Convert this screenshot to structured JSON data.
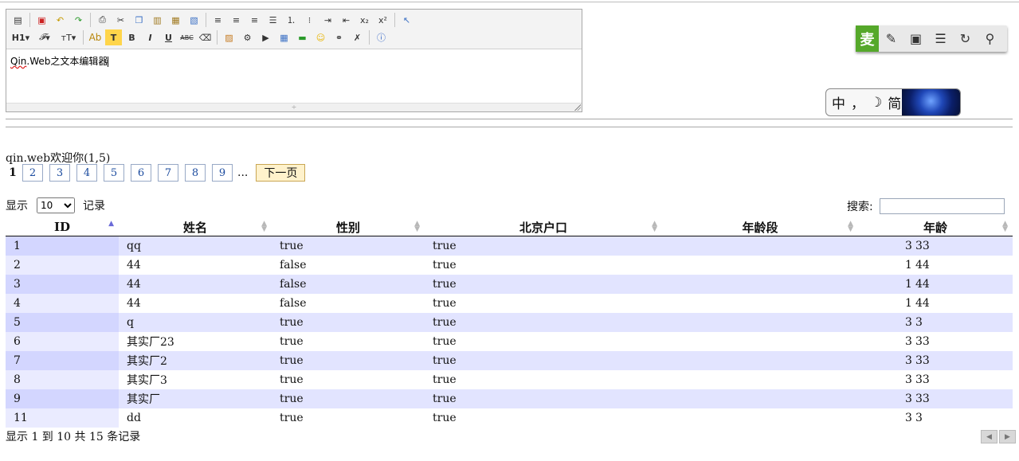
{
  "editor": {
    "toolbar_row1": [
      "source-icon",
      "new-doc-icon",
      "undo-icon",
      "redo-icon",
      "print-icon",
      "cut-icon",
      "copy-icon",
      "paste-icon",
      "paste-text-icon",
      "paste-word-icon",
      "align-left-icon",
      "align-center-icon",
      "align-right-icon",
      "justify-icon",
      "ordered-list-icon",
      "unordered-list-icon",
      "indent-icon",
      "outdent-icon",
      "subscript-icon",
      "superscript-icon",
      "select-icon"
    ],
    "toolbar_row2_labels": {
      "heading": "H1",
      "font_family": "𝐹",
      "font_size": "ᴛ",
      "font_color": "Ab",
      "bg_color": "T",
      "bold": "B",
      "italic": "I",
      "underline": "U",
      "strike": "ABC"
    },
    "content_part1": "Qin",
    "content_part2": ".Web之文本编辑器"
  },
  "widget": {
    "main_label": "麦"
  },
  "ime": {
    "lang": "中",
    "punct": "，",
    "mode": "☽",
    "charset": "简"
  },
  "welcome": "qin.web欢迎你(1,5)",
  "pager": {
    "current": "1",
    "pages": [
      "2",
      "3",
      "4",
      "5",
      "6",
      "7",
      "8",
      "9"
    ],
    "ellipsis": "...",
    "next": "下一页"
  },
  "length": {
    "prefix": "显示",
    "value": "10",
    "suffix": "记录"
  },
  "search": {
    "label": "搜索:",
    "value": ""
  },
  "table": {
    "headers": [
      "ID",
      "姓名",
      "性别",
      "北京户口",
      "年龄段",
      "年龄"
    ],
    "rows": [
      [
        "1",
        "qq",
        "true",
        "true",
        "3",
        "33"
      ],
      [
        "2",
        "44",
        "false",
        "true",
        "1",
        "44"
      ],
      [
        "3",
        "44",
        "false",
        "true",
        "1",
        "44"
      ],
      [
        "4",
        "44",
        "false",
        "true",
        "1",
        "44"
      ],
      [
        "5",
        "q",
        "true",
        "true",
        "3",
        "3"
      ],
      [
        "6",
        "其实厂23",
        "true",
        "true",
        "3",
        "33"
      ],
      [
        "7",
        "其实厂2",
        "true",
        "true",
        "3",
        "33"
      ],
      [
        "8",
        "其实厂3",
        "true",
        "true",
        "3",
        "33"
      ],
      [
        "9",
        "其实厂",
        "true",
        "true",
        "3",
        "33"
      ],
      [
        "11",
        "dd",
        "true",
        "true",
        "3",
        "3"
      ]
    ]
  },
  "info": "显示 1 到 10 共 15 条记录"
}
